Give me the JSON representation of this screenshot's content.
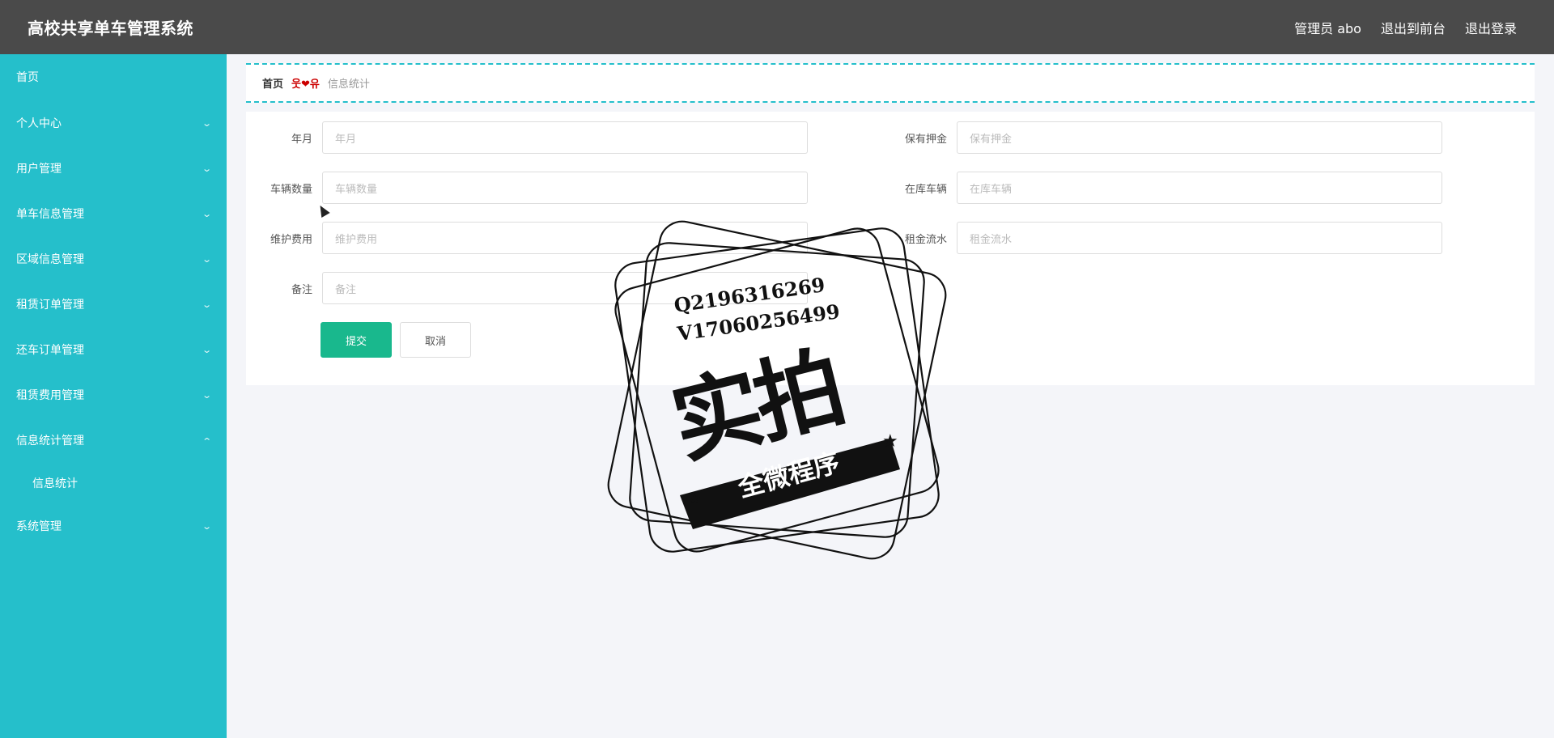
{
  "header": {
    "title": "高校共享单车管理系统",
    "user_label": "管理员 abo",
    "front_label": "退出到前台",
    "logout_label": "退出登录"
  },
  "sidebar": {
    "items": [
      {
        "label": "首页",
        "chevron": ""
      },
      {
        "label": "个人中心",
        "chevron": "chevron-down"
      },
      {
        "label": "用户管理",
        "chevron": "chevron-down"
      },
      {
        "label": "单车信息管理",
        "chevron": "chevron-down"
      },
      {
        "label": "区域信息管理",
        "chevron": "chevron-down"
      },
      {
        "label": "租赁订单管理",
        "chevron": "chevron-down"
      },
      {
        "label": "还车订单管理",
        "chevron": "chevron-down"
      },
      {
        "label": "租赁费用管理",
        "chevron": "chevron-down"
      },
      {
        "label": "信息统计管理",
        "chevron": "chevron-up"
      },
      {
        "label": "信息统计",
        "chevron": ""
      },
      {
        "label": "系统管理",
        "chevron": "chevron-down"
      }
    ]
  },
  "breadcrumb": {
    "home": "首页",
    "separator": "웃❤유",
    "current": "信息统计"
  },
  "form": {
    "fields": [
      {
        "label": "年月",
        "placeholder": "年月"
      },
      {
        "label": "保有押金",
        "placeholder": "保有押金"
      },
      {
        "label": "车辆数量",
        "placeholder": "车辆数量"
      },
      {
        "label": "在库车辆",
        "placeholder": "在库车辆"
      },
      {
        "label": "维护费用",
        "placeholder": "维护费用"
      },
      {
        "label": "租金流水",
        "placeholder": "租金流水"
      },
      {
        "label": "备注",
        "placeholder": "备注"
      }
    ],
    "submit_label": "提交",
    "cancel_label": "取消"
  },
  "watermark": {
    "line1": "Q2196316269",
    "line2": "V17060256499",
    "big": "实拍",
    "ribbon": "全微程序"
  },
  "colors": {
    "header_bg": "#4a4a4a",
    "sidebar_bg": "#25bfcb",
    "submit_bg": "#19b88d",
    "page_bg": "#f4f5f9"
  }
}
